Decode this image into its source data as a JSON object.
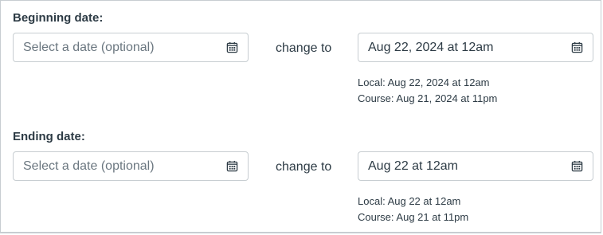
{
  "beginning": {
    "label": "Beginning date:",
    "input_placeholder": "Select a date (optional)",
    "change_to": "change to",
    "new_value": "Aug 22, 2024 at 12am",
    "local": "Local: Aug 22, 2024 at 12am",
    "course": "Course: Aug 21, 2024 at 11pm"
  },
  "ending": {
    "label": "Ending date:",
    "input_placeholder": "Select a date (optional)",
    "change_to": "change to",
    "new_value": "Aug 22 at 12am",
    "local": "Local: Aug 22 at 12am",
    "course": "Course: Aug 21 at 11pm"
  },
  "icons": {
    "calendar": "calendar-icon"
  },
  "colors": {
    "text": "#2d3b45",
    "placeholder": "#6b7780",
    "border": "#c7cdd1"
  }
}
